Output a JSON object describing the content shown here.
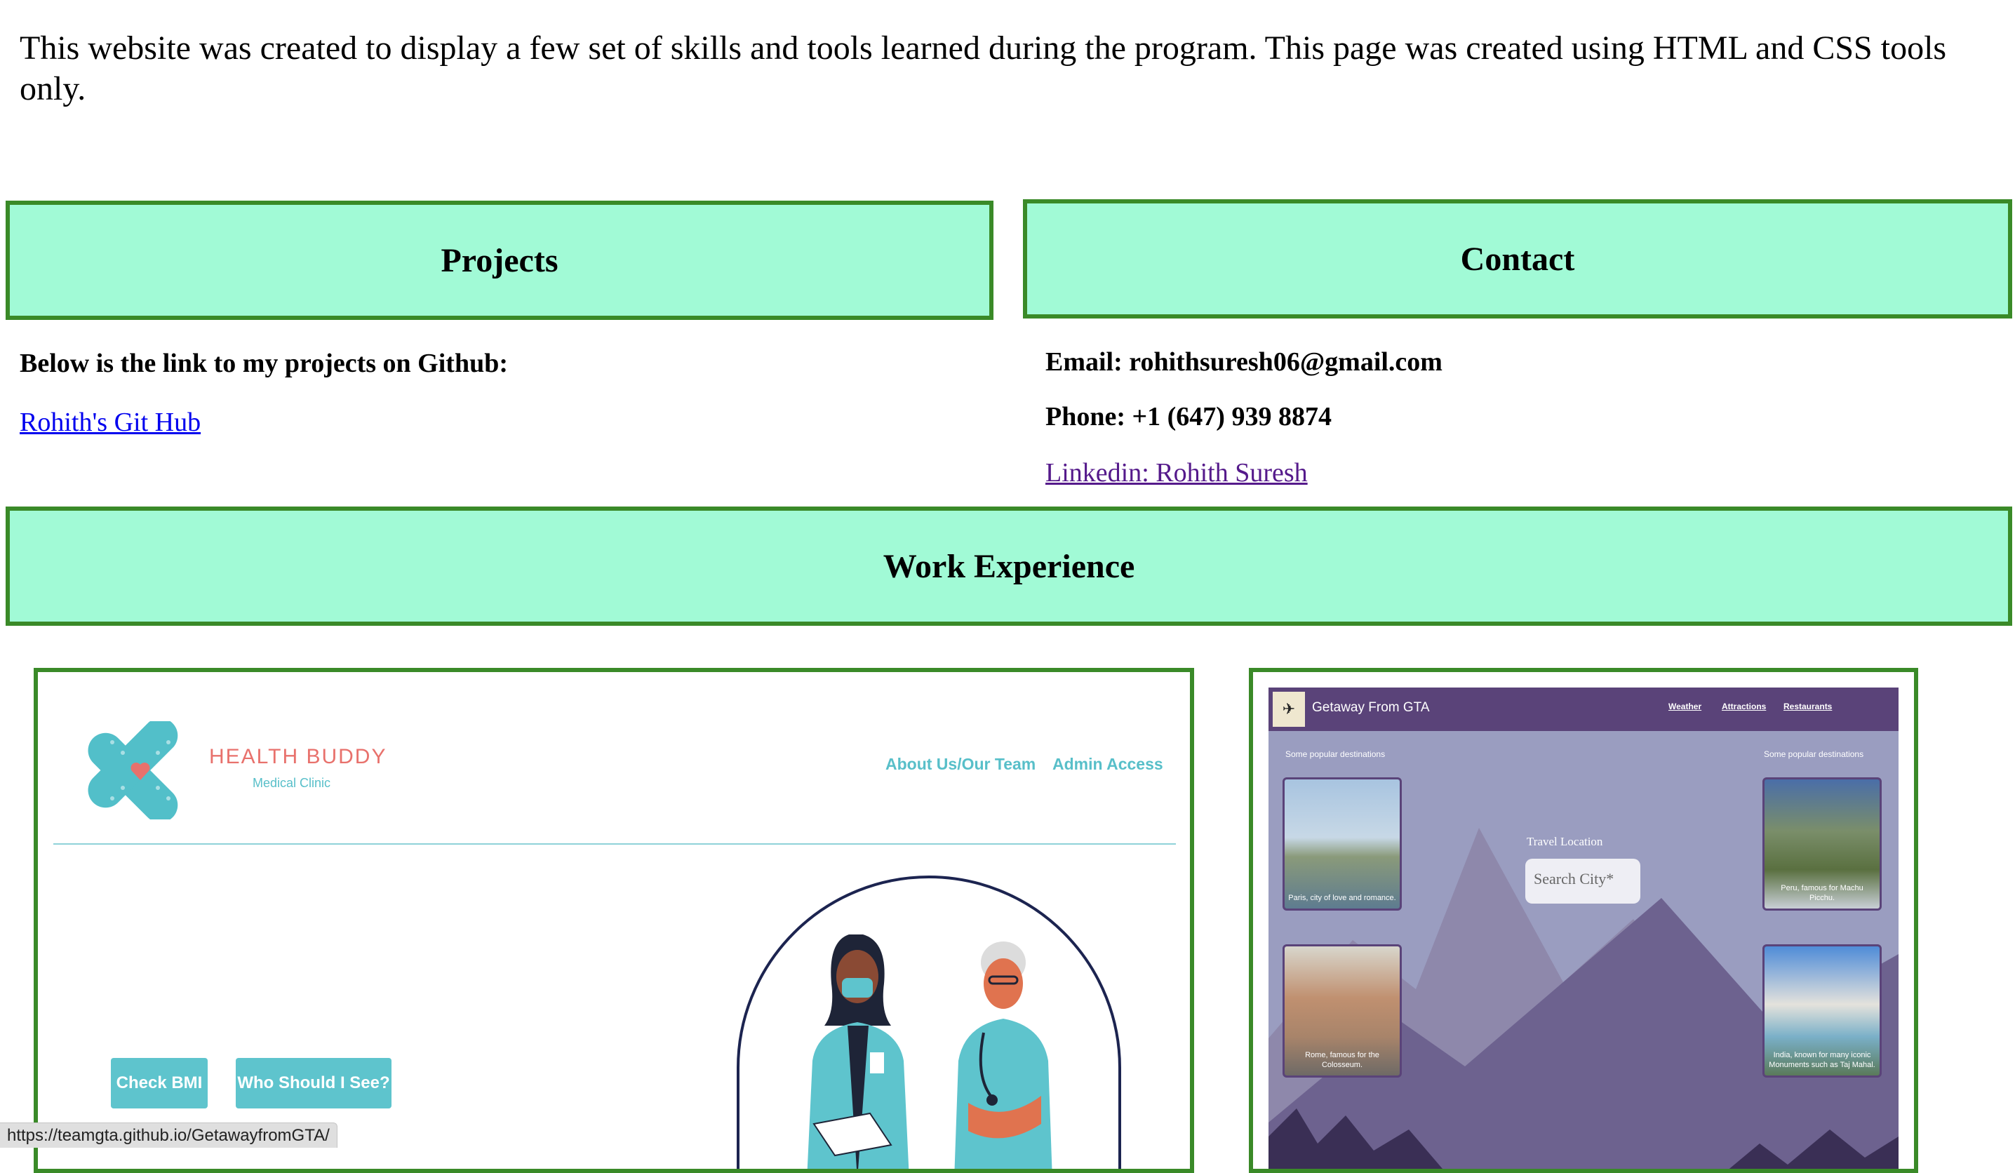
{
  "intro": "This website was created to display a few set of skills and tools learned during the program. This page was created using HTML and CSS tools only.",
  "projects": {
    "heading": "Projects",
    "text": "Below is the link to my projects on Github:",
    "link": "Rohith's Git Hub"
  },
  "contact": {
    "heading": "Contact",
    "email": "Email: rohithsuresh06@gmail.com",
    "phone": "Phone: +1 (647) 939 8874",
    "linkedin": "Linkedin: Rohith Suresh"
  },
  "work": {
    "heading": "Work Experience"
  },
  "health_buddy": {
    "name": "HEALTH BUDDY",
    "subtitle": "Medical Clinic",
    "nav": [
      "About Us/Our Team",
      "Admin Access"
    ],
    "buttons": [
      "Check BMI",
      "Who Should I See?"
    ]
  },
  "gta": {
    "title": "Getaway From GTA",
    "nav": [
      "Weather",
      "Attractions",
      "Restaurants"
    ],
    "popular_left": "Some popular destinations",
    "popular_right": "Some popular destinations",
    "search_label": "Travel Location",
    "search_placeholder": "Search City*",
    "captions": [
      "Paris, city of love and romance.",
      "Peru, famous for Machu Picchu.",
      "Rome, famous for the Colosseum.",
      "India, known for many iconic Monuments such as Taj Mahal."
    ]
  },
  "status_url": "https://teamgta.github.io/GetawayfromGTA/",
  "colors": {
    "section_bg": "#a1fad6",
    "section_border": "#3a8a28",
    "teal": "#5ec4cd",
    "coral": "#e8716c",
    "purple": "#5a4379"
  }
}
